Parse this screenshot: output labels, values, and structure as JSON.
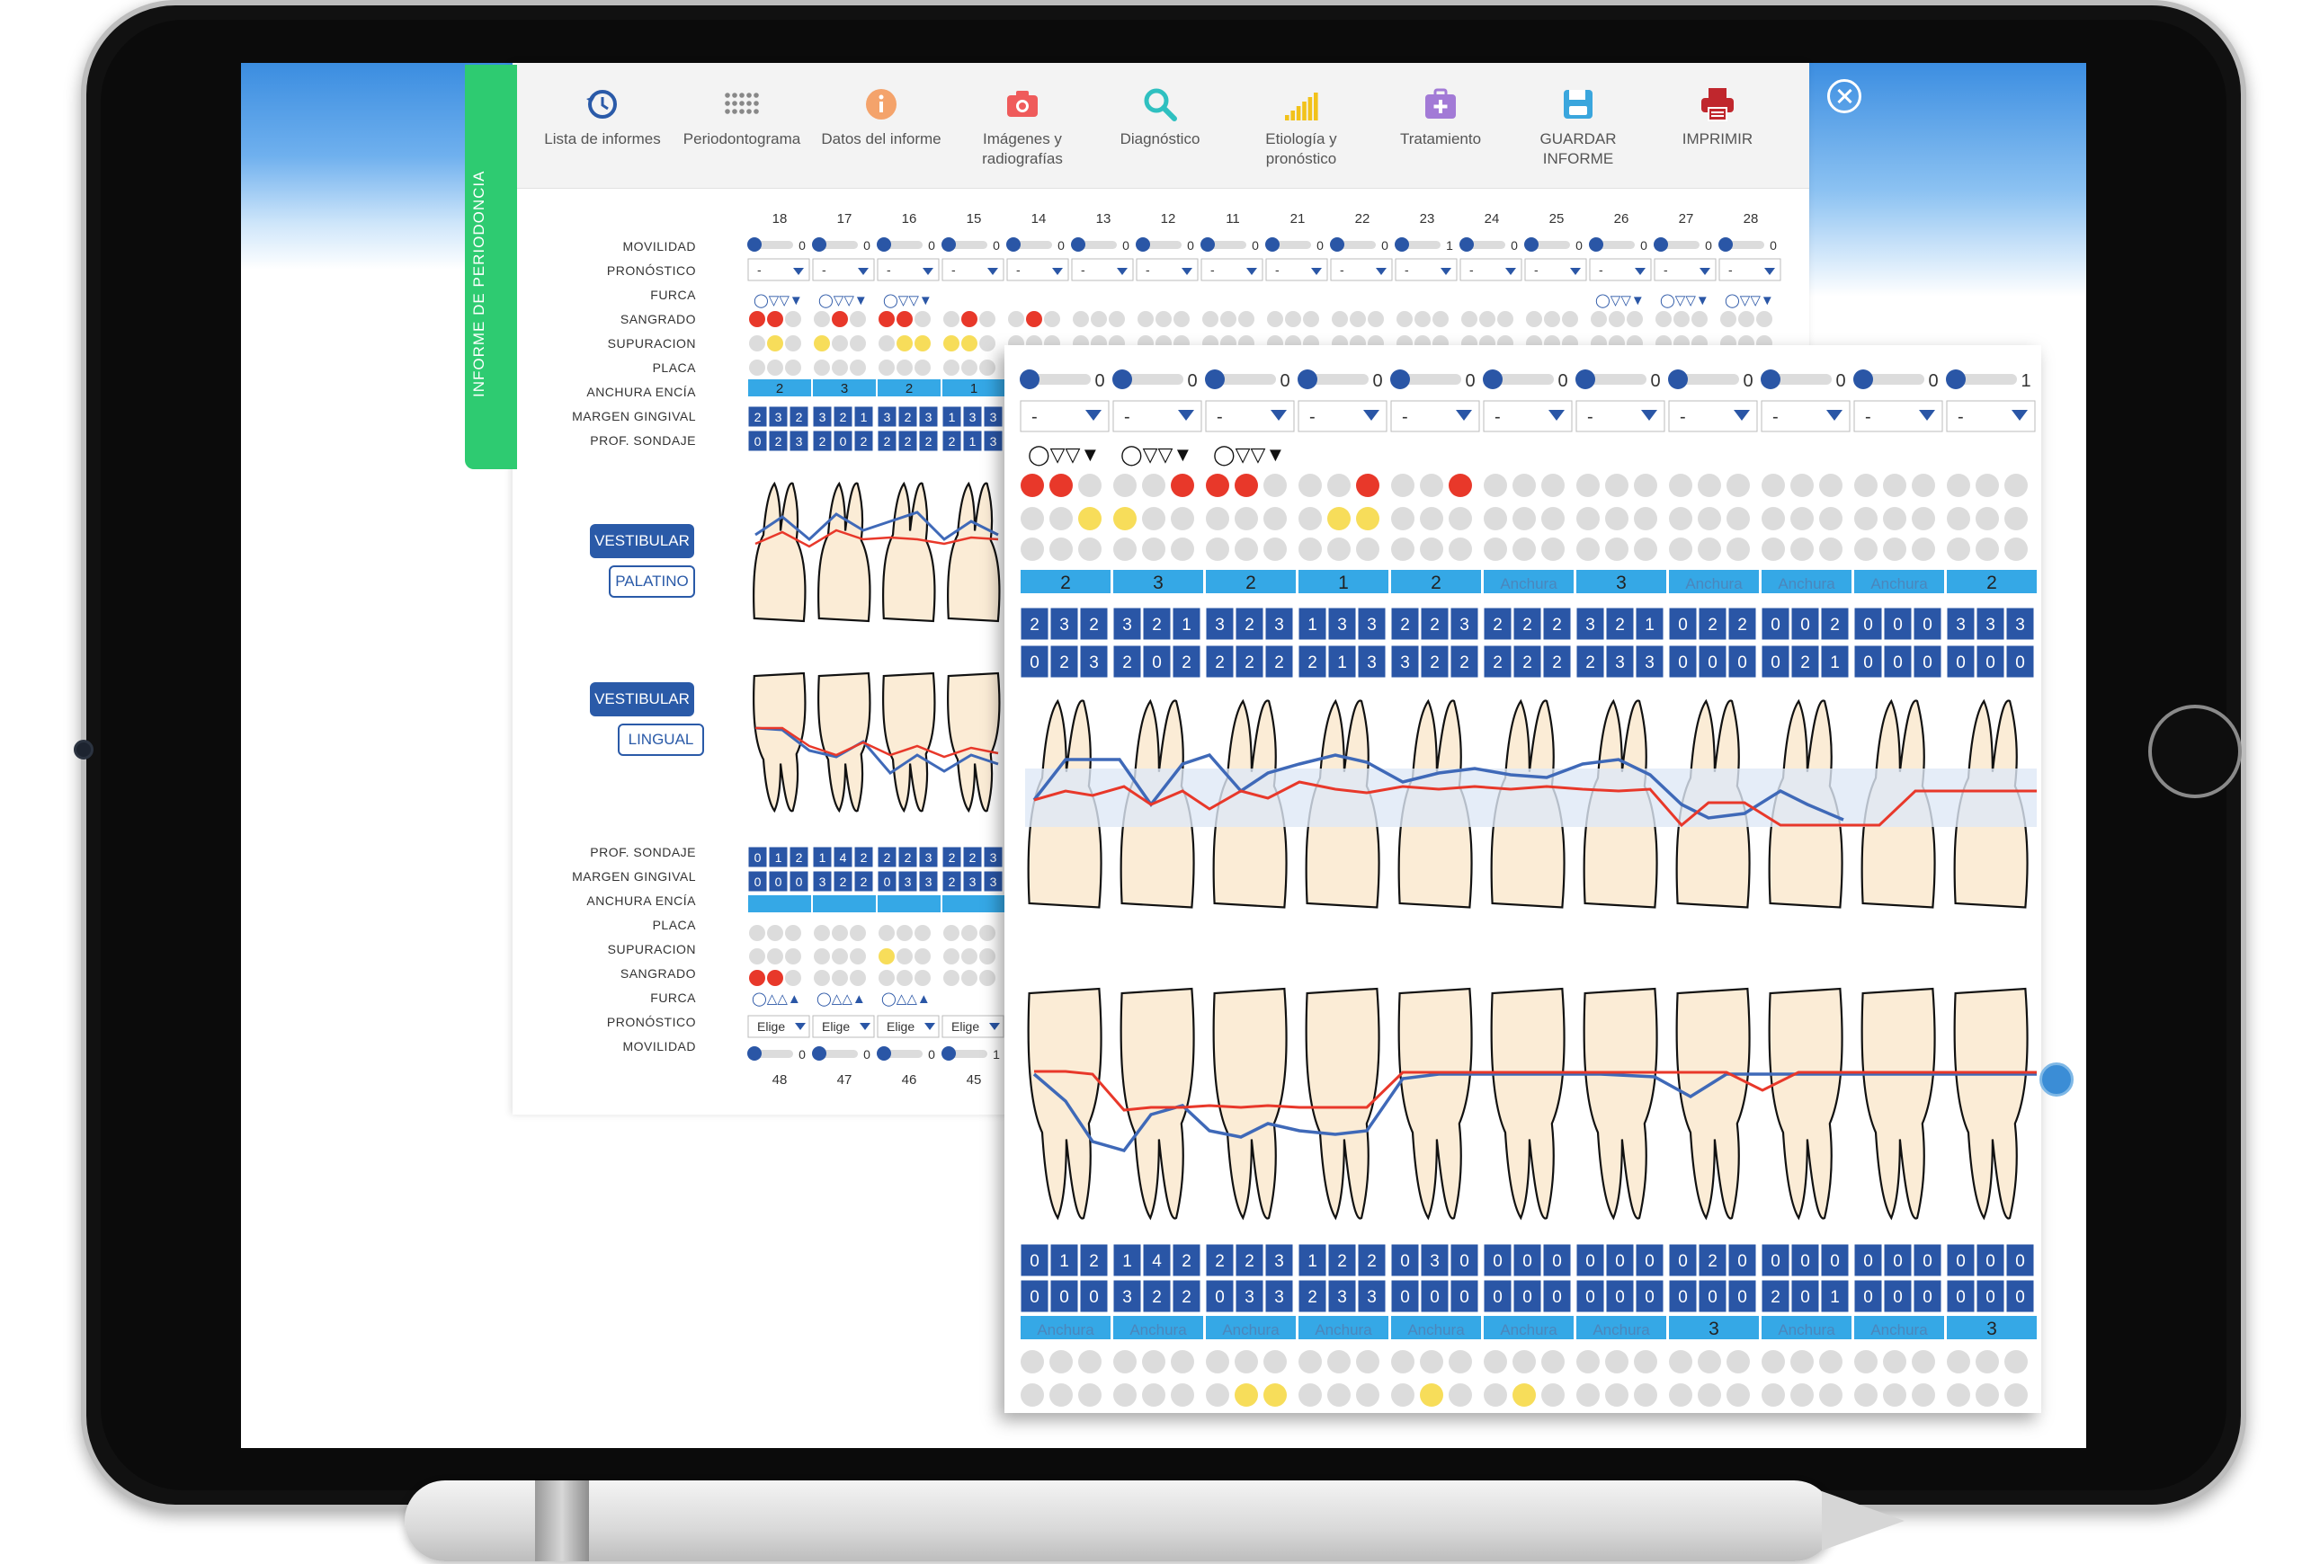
{
  "side_tab": "INFORME DE PERIODONCIA",
  "toolbar": [
    {
      "label": "Lista de informes",
      "icon": "history-icon",
      "color": "#2a5aa8"
    },
    {
      "label": "Periodontograma",
      "icon": "dots-grid-icon",
      "color": "#888888"
    },
    {
      "label": "Datos del informe",
      "icon": "info-icon",
      "color": "#f4a36b"
    },
    {
      "label": "Imágenes y radiografías",
      "icon": "camera-icon",
      "color": "#ef5b5b"
    },
    {
      "label": "Diagnóstico",
      "icon": "search-icon",
      "color": "#2fc0c0"
    },
    {
      "label": "Etiología y pronóstico",
      "icon": "signal-bars-icon",
      "color": "#f2c21a"
    },
    {
      "label": "Tratamiento",
      "icon": "medkit-icon",
      "color": "#a27ad6"
    },
    {
      "label": "GUARDAR INFORME",
      "icon": "save-icon",
      "color": "#3aa6dd"
    },
    {
      "label": "IMPRIMIR",
      "icon": "printer-icon",
      "color": "#c0272d"
    }
  ],
  "upper_teeth": [
    "18",
    "17",
    "16",
    "15",
    "14",
    "13",
    "12",
    "11",
    "21",
    "22",
    "23",
    "24",
    "25",
    "26",
    "27",
    "28"
  ],
  "lower_teeth": [
    "48",
    "47",
    "46",
    "45"
  ],
  "upper_rows": [
    "MOVILIDAD",
    "PRONÓSTICO",
    "FURCA",
    "SANGRADO",
    "SUPURACION",
    "PLACA",
    "ANCHURA ENCÍA",
    "MARGEN GINGIVAL",
    "PROF. SONDAJE"
  ],
  "lower_rows": [
    "PROF. SONDAJE",
    "MARGEN GINGIVAL",
    "ANCHURA ENCÍA",
    "PLACA",
    "SUPURACION",
    "SANGRADO",
    "FURCA",
    "PRONÓSTICO",
    "MOVILIDAD"
  ],
  "movilidad_upper": [
    "0",
    "0",
    "0",
    "0",
    "0",
    "0",
    "0",
    "0",
    "0",
    "0",
    "1",
    "0",
    "0",
    "0",
    "0",
    "0"
  ],
  "movilidad_lower": [
    "0",
    "0",
    "0",
    "1"
  ],
  "pronostico_default": "-",
  "pronostico_lower": "Elige",
  "anchura_back": [
    "2",
    "3",
    "2",
    "1"
  ],
  "view_buttons": {
    "vestibular": "VESTIBULAR",
    "palatino": "PALATINO",
    "lingual": "LINGUAL"
  },
  "furca_upper": "◯▽▽▼",
  "furca_lower": "◯△△▲",
  "front": {
    "movilidad": [
      "0",
      "0",
      "0",
      "0",
      "0",
      "0",
      "0",
      "0",
      "0",
      "0",
      "1"
    ],
    "anchura": [
      "2",
      "3",
      "2",
      "1",
      "2",
      "Anchura",
      "3",
      "Anchura",
      "Anchura",
      "Anchura",
      "2"
    ],
    "margen": [
      [
        "2",
        "3",
        "2"
      ],
      [
        "3",
        "2",
        "1"
      ],
      [
        "3",
        "2",
        "3"
      ],
      [
        "1",
        "3",
        "3"
      ],
      [
        "2",
        "2",
        "3"
      ],
      [
        "2",
        "2",
        "2"
      ],
      [
        "3",
        "2",
        "1"
      ],
      [
        "0",
        "2",
        "2"
      ],
      [
        "0",
        "0",
        "2"
      ],
      [
        "0",
        "0",
        "0"
      ],
      [
        "3",
        "3",
        "3"
      ]
    ],
    "sondaje": [
      [
        "0",
        "2",
        "3"
      ],
      [
        "2",
        "0",
        "2"
      ],
      [
        "2",
        "2",
        "2"
      ],
      [
        "2",
        "1",
        "3"
      ],
      [
        "3",
        "2",
        "2"
      ],
      [
        "2",
        "2",
        "2"
      ],
      [
        "2",
        "3",
        "3"
      ],
      [
        "0",
        "0",
        "0"
      ],
      [
        "0",
        "2",
        "1"
      ],
      [
        "0",
        "0",
        "0"
      ],
      [
        "0",
        "0",
        "0"
      ]
    ],
    "lower_sondaje": [
      [
        "0",
        "1",
        "2"
      ],
      [
        "1",
        "4",
        "2"
      ],
      [
        "2",
        "2",
        "3"
      ],
      [
        "1",
        "2",
        "2"
      ],
      [
        "0",
        "3",
        "0"
      ],
      [
        "0",
        "0",
        "0"
      ],
      [
        "0",
        "0",
        "0"
      ],
      [
        "0",
        "2",
        "0"
      ],
      [
        "0",
        "0",
        "0"
      ],
      [
        "0",
        "0",
        "0"
      ],
      [
        "0",
        "0",
        "0"
      ]
    ],
    "lower_margen": [
      [
        "0",
        "0",
        "0"
      ],
      [
        "3",
        "2",
        "2"
      ],
      [
        "0",
        "3",
        "3"
      ],
      [
        "2",
        "3",
        "3"
      ],
      [
        "0",
        "0",
        "0"
      ],
      [
        "0",
        "0",
        "0"
      ],
      [
        "0",
        "0",
        "0"
      ],
      [
        "0",
        "0",
        "0"
      ],
      [
        "2",
        "0",
        "1"
      ],
      [
        "0",
        "0",
        "0"
      ],
      [
        "0",
        "0",
        "0"
      ]
    ],
    "lower_anchura": [
      "Anchura",
      "Anchura",
      "Anchura",
      "Anchura",
      "Anchura",
      "Anchura",
      "Anchura",
      "3",
      "Anchura",
      "Anchura",
      "3"
    ]
  },
  "back_margen": [
    [
      "2",
      "3",
      "2"
    ],
    [
      "3",
      "2",
      "1"
    ],
    [
      "3",
      "2",
      "3"
    ],
    [
      "1",
      "3",
      "3"
    ]
  ],
  "back_sondaje": [
    [
      "0",
      "2",
      "3"
    ],
    [
      "2",
      "0",
      "2"
    ],
    [
      "2",
      "2",
      "2"
    ],
    [
      "2",
      "1",
      "3"
    ]
  ],
  "back_low_sondaje": [
    [
      "0",
      "1",
      "2"
    ],
    [
      "1",
      "4",
      "2"
    ],
    [
      "2",
      "2",
      "3"
    ],
    [
      "2",
      "2",
      "3"
    ]
  ],
  "back_low_margen": [
    [
      "0",
      "0",
      "0"
    ],
    [
      "3",
      "2",
      "2"
    ],
    [
      "0",
      "3",
      "3"
    ],
    [
      "2",
      "3",
      "3"
    ]
  ],
  "colors": {
    "accent_blue": "#2a5aa8",
    "cell_blue": "#2a56a6",
    "band_blue": "#35a8e6",
    "bleeding_red": "#e8382a",
    "supuracion_yellow": "#f7dd5a",
    "green_tab": "#2ecb71"
  }
}
